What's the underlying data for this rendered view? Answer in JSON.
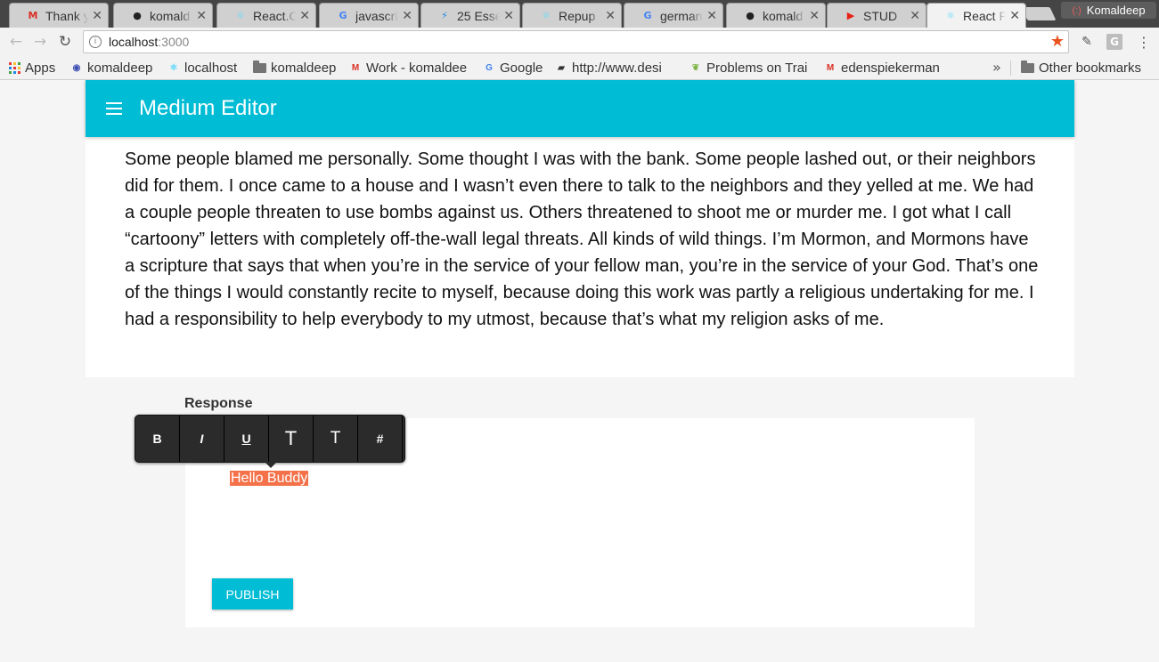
{
  "browser": {
    "tabs": [
      {
        "title": "Thank y",
        "icon": "gmail-icon",
        "color": "#d93025",
        "glyph": "M"
      },
      {
        "title": "komald",
        "icon": "github-icon",
        "color": "#222222",
        "glyph": "●"
      },
      {
        "title": "React.C",
        "icon": "react-icon",
        "color": "#61dafb",
        "glyph": "⚛"
      },
      {
        "title": "javascri",
        "icon": "google-icon",
        "color": "#4285f4",
        "glyph": "G"
      },
      {
        "title": "25 Esse",
        "icon": "bolt-icon",
        "color": "#1e88e5",
        "glyph": "⚡"
      },
      {
        "title": "Repup",
        "icon": "react-icon",
        "color": "#61dafb",
        "glyph": "⚛"
      },
      {
        "title": "german",
        "icon": "google-icon",
        "color": "#4285f4",
        "glyph": "G"
      },
      {
        "title": "komald",
        "icon": "github-icon",
        "color": "#222222",
        "glyph": "●"
      },
      {
        "title": "STUD",
        "icon": "youtube-icon",
        "color": "#e62117",
        "glyph": "▶"
      },
      {
        "title": "React P",
        "icon": "react-icon",
        "color": "#61dafb",
        "glyph": "⚛"
      }
    ],
    "profile_name": "Komaldeep",
    "address": {
      "host": "localhost",
      "port": ":3000"
    },
    "bookmarks": [
      {
        "label": "Apps",
        "icon": "apps-icon"
      },
      {
        "label": "komaldeep",
        "icon": "shield-icon"
      },
      {
        "label": "localhost",
        "icon": "react-icon"
      },
      {
        "label": "komaldeep",
        "icon": "folder-icon"
      },
      {
        "label": "Work - komaldee",
        "icon": "gmail-icon"
      },
      {
        "label": "Google",
        "icon": "google-icon"
      },
      {
        "label": "http://www.desi",
        "icon": "site-icon"
      },
      {
        "label": "Problems on Trai",
        "icon": "leaf-icon"
      },
      {
        "label": "edenspiekerman",
        "icon": "gmail-icon"
      }
    ],
    "other_bookmarks": "Other bookmarks"
  },
  "app": {
    "title": "Medium Editor",
    "accent_color": "#00bcd4",
    "article_text": "Some people blamed me personally. Some thought I was with the bank. Some people lashed out, or their neighbors did for them. I once came to a house and I wasn’t even there to talk to the neighbors and they yelled at me. We had a couple people threaten to use bombs against us. Others threatened to shoot me or murder me. I got what I call “cartoony” letters with completely off-the-wall legal threats. All kinds of wild things. I’m Mormon, and Mormons have a scripture that says that when you’re in the service of your fellow man, you’re in the service of your God. That’s one of the things I would constantly recite to myself, because doing this work was partly a religious undertaking for me. I had a responsibility to help everybody to my utmost, because that’s what my religion asks of me.",
    "response_label": "Response",
    "response_text": "Hello Buddy",
    "selection_color": "#f4714a",
    "publish_label": "PUBLISH",
    "format_toolbar": {
      "bold": "B",
      "italic": "I",
      "underline": "U",
      "h1": "T",
      "h2": "T",
      "hash": "#"
    }
  }
}
